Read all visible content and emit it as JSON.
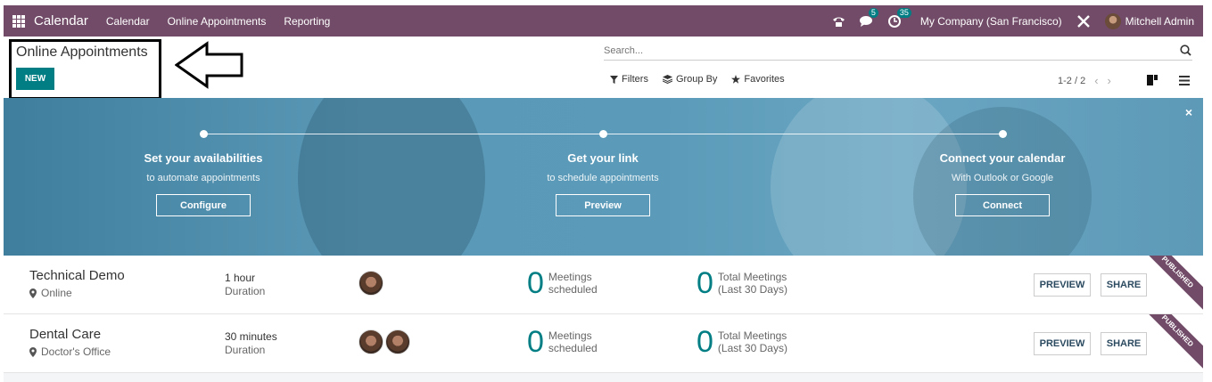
{
  "navbar": {
    "brand": "Calendar",
    "menus": [
      "Calendar",
      "Online Appointments",
      "Reporting"
    ],
    "messages_badge": "5",
    "activities_badge": "35",
    "company": "My Company (San Francisco)",
    "user": "Mitchell Admin"
  },
  "control_panel": {
    "title": "Online Appointments",
    "new_label": "NEW",
    "search_placeholder": "Search...",
    "filters_label": "Filters",
    "group_by_label": "Group By",
    "favorites_label": "Favorites",
    "pager": "1-2 / 2"
  },
  "banner": {
    "steps": [
      {
        "title": "Set your availabilities",
        "subtitle": "to automate appointments",
        "button": "Configure"
      },
      {
        "title": "Get your link",
        "subtitle": "to schedule appointments",
        "button": "Preview"
      },
      {
        "title": "Connect your calendar",
        "subtitle": "With Outlook or Google",
        "button": "Connect"
      }
    ]
  },
  "appointments": [
    {
      "name": "Technical Demo",
      "location": "Online",
      "duration": "1 hour",
      "duration_label": "Duration",
      "meetings_count": "0",
      "meetings_label_1": "Meetings",
      "meetings_label_2": "scheduled",
      "total_count": "0",
      "total_label_1": "Total Meetings",
      "total_label_2": "(Last 30 Days)",
      "preview_label": "PREVIEW",
      "share_label": "SHARE",
      "ribbon": "PUBLISHED"
    },
    {
      "name": "Dental Care",
      "location": "Doctor's Office",
      "duration": "30 minutes",
      "duration_label": "Duration",
      "meetings_count": "0",
      "meetings_label_1": "Meetings",
      "meetings_label_2": "scheduled",
      "total_count": "0",
      "total_label_1": "Total Meetings",
      "total_label_2": "(Last 30 Days)",
      "preview_label": "PREVIEW",
      "share_label": "SHARE",
      "ribbon": "PUBLISHED"
    }
  ],
  "colors": {
    "navbar": "#714b67",
    "primary": "#017e84",
    "banner": "#5b9bb9"
  }
}
